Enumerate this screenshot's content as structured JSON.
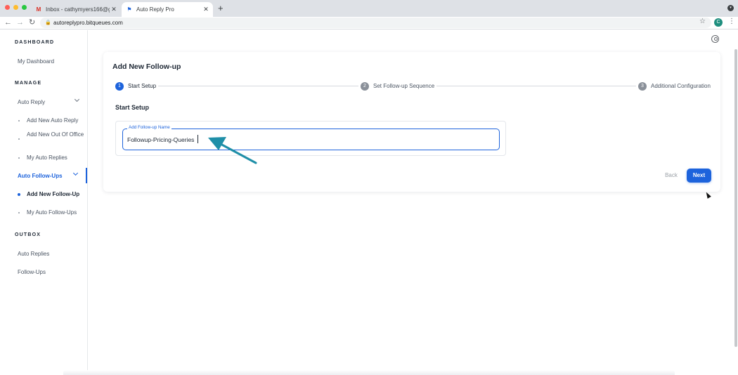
{
  "browser": {
    "tabs": [
      {
        "title": "Inbox - cathymyers166@gmail.",
        "icon": "gmail-icon",
        "active": false
      },
      {
        "title": "Auto Reply Pro",
        "icon": "app-favicon",
        "active": true
      }
    ],
    "new_tab": "+",
    "url": "autoreplypro.bitqueues.com",
    "profile_initial": "C"
  },
  "sidebar": {
    "sections": {
      "dashboard": "DASHBOARD",
      "manage": "MANAGE",
      "outbox": "OUTBOX"
    },
    "my_dashboard": "My Dashboard",
    "auto_reply": {
      "label": "Auto Reply",
      "items": [
        "Add New Auto Reply",
        "Add New Out Of Office",
        "My Auto Replies"
      ]
    },
    "auto_followups": {
      "label": "Auto Follow-Ups",
      "items": [
        "Add New Follow-Up",
        "My Auto Follow-Ups"
      ],
      "active_item": "Add New Follow-Up"
    },
    "outbox_items": [
      "Auto Replies",
      "Follow-Ups"
    ]
  },
  "card": {
    "title": "Add New Follow-up",
    "steps": [
      {
        "number": "1",
        "label": "Start Setup",
        "active": true
      },
      {
        "number": "2",
        "label": "Set Follow-up Sequence",
        "active": false
      },
      {
        "number": "3",
        "label": "Additional Configuration",
        "active": false
      }
    ],
    "section_heading": "Start Setup",
    "field": {
      "label": "Add Follow-up Name",
      "value": "Followup-Pricing-Queries"
    },
    "back_label": "Back",
    "next_label": "Next"
  },
  "colors": {
    "accent": "#1d63dc",
    "annotation_arrow": "#1f8fa8"
  }
}
